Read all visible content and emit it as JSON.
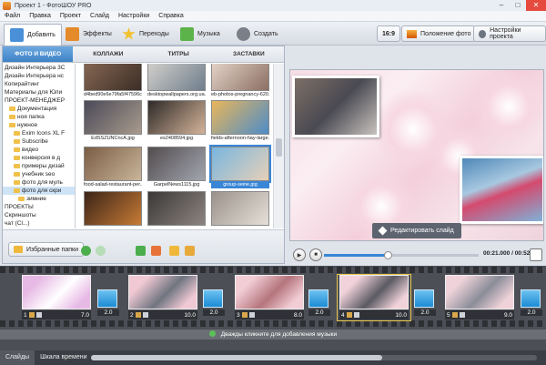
{
  "window": {
    "title": "Проект 1 - ФотоШОУ PRO",
    "buttons": [
      "–",
      "□",
      "✕"
    ]
  },
  "menu": [
    "Файл",
    "Правка",
    "Проект",
    "Слайд",
    "Настройки",
    "Справка"
  ],
  "toolbar": {
    "tabs": [
      {
        "label": "Добавить",
        "icon": "add-folder-icon",
        "color": "#4a90d9",
        "active": true
      },
      {
        "label": "Эффекты",
        "icon": "brush-icon",
        "color": "#e58a2a",
        "active": false
      },
      {
        "label": "Переходы",
        "icon": "star-icon",
        "color": "#f2c12e",
        "active": false
      },
      {
        "label": "Музыка",
        "icon": "music-icon",
        "color": "#5bb34a",
        "active": false
      },
      {
        "label": "Создать",
        "icon": "film-reel-icon",
        "color": "#7a7f88",
        "active": false
      }
    ],
    "aspect_ratio": "16:9",
    "photo_position": "Положение фото",
    "project_settings": "Настройки проекта"
  },
  "left_panel": {
    "subtabs": [
      "ФОТО И ВИДЕО",
      "КОЛЛАЖИ",
      "ТИТРЫ",
      "ЗАСТАВКИ"
    ],
    "tree": [
      {
        "label": "Дизайн Интерьера 3С",
        "folder": false,
        "indent": 0
      },
      {
        "label": "Дизайн Интерьера нс",
        "folder": false,
        "indent": 0
      },
      {
        "label": "Копирайтинг",
        "folder": false,
        "indent": 0
      },
      {
        "label": "Материалы для Юли",
        "folder": false,
        "indent": 0
      },
      {
        "label": "ПРОЕКТ-МЕНЕДЖЕР",
        "folder": false,
        "indent": 0
      },
      {
        "label": "Документация",
        "folder": true,
        "indent": 1
      },
      {
        "label": "ноя папка",
        "folder": true,
        "indent": 1
      },
      {
        "label": "нужное",
        "folder": true,
        "indent": 1
      },
      {
        "label": "Exim Icons XL F",
        "folder": true,
        "indent": 2
      },
      {
        "label": "Subscribe",
        "folder": true,
        "indent": 2
      },
      {
        "label": "видео",
        "folder": true,
        "indent": 2
      },
      {
        "label": "конверсия в д",
        "folder": true,
        "indent": 2
      },
      {
        "label": "примеры дизай",
        "folder": true,
        "indent": 2
      },
      {
        "label": "учебник seo",
        "folder": true,
        "indent": 2
      },
      {
        "label": "фото для муль",
        "folder": true,
        "indent": 2
      },
      {
        "label": "фото для скри",
        "folder": true,
        "indent": 2,
        "selected": true
      },
      {
        "label": "зимние",
        "folder": true,
        "indent": 3
      },
      {
        "label": "ПРОЕКТЫ",
        "folder": false,
        "indent": 0
      },
      {
        "label": "Скриншоты",
        "folder": false,
        "indent": 0
      },
      {
        "label": "чат (Cl...)",
        "folder": false,
        "indent": 0
      }
    ],
    "thumbnails": [
      {
        "caption": "d4bed90e6e79fa5f47596c...",
        "c1": "#8a6a55",
        "c2": "#3b2e26"
      },
      {
        "caption": "desktopwallpapers.org.ua...",
        "c1": "#d8d4cf",
        "c2": "#6f7e8c"
      },
      {
        "caption": "eb-photos-pregnancy-620...",
        "c1": "#e9d9cf",
        "c2": "#8c6f62"
      },
      {
        "caption": "EdSSZUNCncA.jpg",
        "c1": "#4b4a58",
        "c2": "#a89a8c"
      },
      {
        "caption": "es2408594.jpg",
        "c1": "#2e2a28",
        "c2": "#d5b49a"
      },
      {
        "caption": "fields-afternoon-hay-large...",
        "c1": "#e9b65a",
        "c2": "#4d8cc8"
      },
      {
        "caption": "food-salad-restaurant-per...",
        "c1": "#7a5d44",
        "c2": "#c9b59a"
      },
      {
        "caption": "GarpelNews1115.jpg",
        "c1": "#524c4e",
        "c2": "#a2a6b0"
      },
      {
        "caption": "group-selfie.jpg",
        "c1": "#78b6df",
        "c2": "#e6d0b8",
        "selected": true
      },
      {
        "caption": "",
        "c1": "#3b2418",
        "c2": "#c77b35"
      },
      {
        "caption": "",
        "c1": "#3a3837",
        "c2": "#8d8480"
      },
      {
        "caption": "",
        "c1": "#9a918a",
        "c2": "#e6e0d8"
      }
    ],
    "favorites_label": "Избранные папки",
    "nav_icons": [
      "back-arrow-icon",
      "forward-arrow-icon",
      "down-arrow-icon",
      "home-icon",
      "new-folder-icon",
      "folder-icon"
    ]
  },
  "preview": {
    "edit_button": "Редактировать слайд",
    "timecode": "00:21.000 / 00:52.000",
    "progress": 0.41
  },
  "timeline": {
    "slides": [
      {
        "number": "1",
        "duration": "7.0",
        "c1": "#e7b9e5",
        "c2": "#ffffff"
      },
      {
        "number": "2",
        "duration": "10.0",
        "c1": "#f0c9d4",
        "c2": "#6f7580"
      },
      {
        "number": "3",
        "duration": "8.0",
        "c1": "#f2cdd6",
        "c2": "#b5757c"
      },
      {
        "number": "4",
        "duration": "10.0",
        "c1": "#f1d2da",
        "c2": "#5a5a62",
        "active": true
      },
      {
        "number": "5",
        "duration": "9.0",
        "c1": "#f0d3da",
        "c2": "#8a8d98"
      }
    ],
    "transitions": [
      "2.0",
      "2.0",
      "2.0",
      "2.0",
      "2.0"
    ],
    "music_hint": "Дважды кликните для добавления музыки"
  },
  "bottom_tabs": [
    {
      "label": "Слайды",
      "active": true
    },
    {
      "label": "Шкала времени",
      "active": false
    }
  ]
}
